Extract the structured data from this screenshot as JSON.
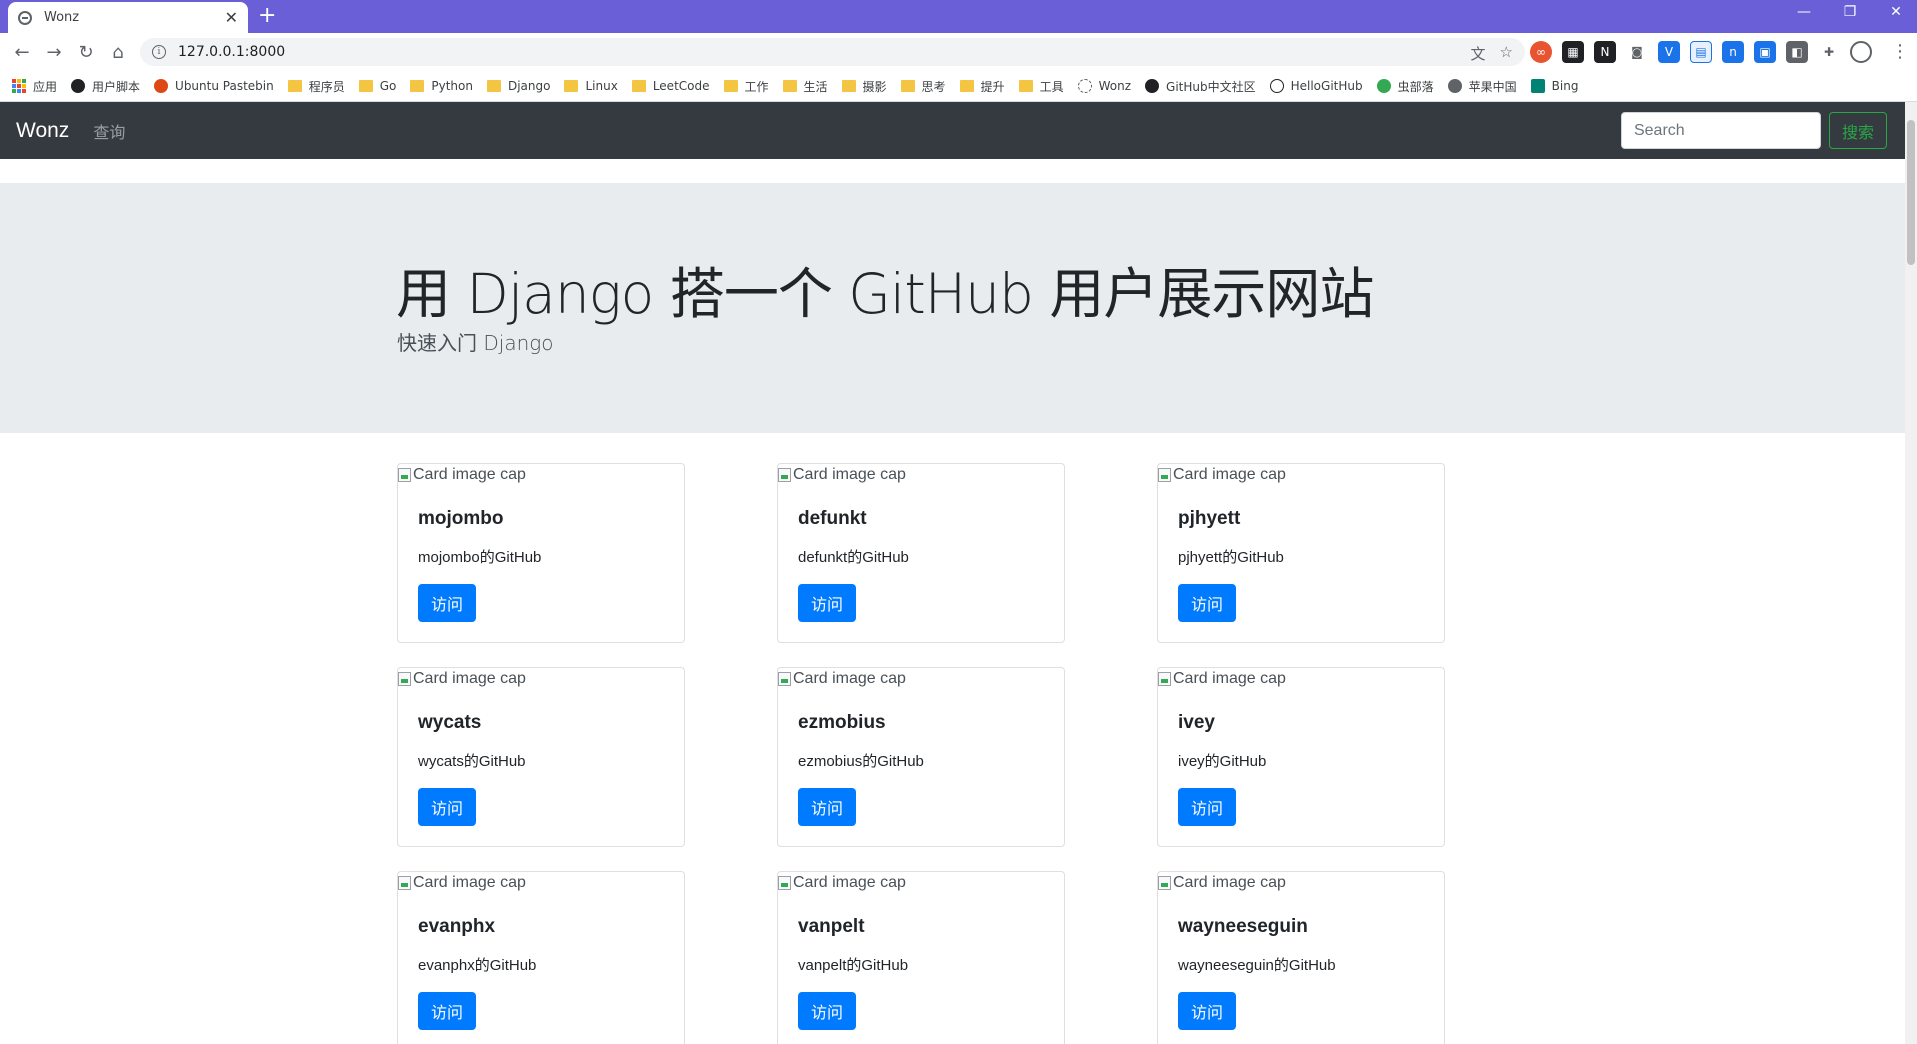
{
  "browser": {
    "tab_title": "Wonz",
    "url": "127.0.0.1:8000",
    "bookmarks": [
      "应用",
      "用户脚本",
      "Ubuntu Pastebin",
      "程序员",
      "Go",
      "Python",
      "Django",
      "Linux",
      "LeetCode",
      "工作",
      "生活",
      "摄影",
      "思考",
      "提升",
      "工具",
      "Wonz",
      "GitHub中文社区",
      "HelloGitHub",
      "虫部落",
      "苹果中国",
      "Bing"
    ]
  },
  "navbar": {
    "brand": "Wonz",
    "link": "查询",
    "search_placeholder": "Search",
    "search_button": "搜索"
  },
  "jumbotron": {
    "title": "用 Django 搭一个 GitHub 用户展示网站",
    "subtitle": "快速入门 Django"
  },
  "cards": [
    {
      "img_alt": "Card image cap",
      "title": "mojombo",
      "text": "mojombo的GitHub",
      "button": "访问"
    },
    {
      "img_alt": "Card image cap",
      "title": "defunkt",
      "text": "defunkt的GitHub",
      "button": "访问"
    },
    {
      "img_alt": "Card image cap",
      "title": "pjhyett",
      "text": "pjhyett的GitHub",
      "button": "访问"
    },
    {
      "img_alt": "Card image cap",
      "title": "wycats",
      "text": "wycats的GitHub",
      "button": "访问"
    },
    {
      "img_alt": "Card image cap",
      "title": "ezmobius",
      "text": "ezmobius的GitHub",
      "button": "访问"
    },
    {
      "img_alt": "Card image cap",
      "title": "ivey",
      "text": "ivey的GitHub",
      "button": "访问"
    },
    {
      "img_alt": "Card image cap",
      "title": "evanphx",
      "text": "evanphx的GitHub",
      "button": "访问"
    },
    {
      "img_alt": "Card image cap",
      "title": "vanpelt",
      "text": "vanpelt的GitHub",
      "button": "访问"
    },
    {
      "img_alt": "Card image cap",
      "title": "wayneeseguin",
      "text": "wayneeseguin的GitHub",
      "button": "访问"
    }
  ]
}
